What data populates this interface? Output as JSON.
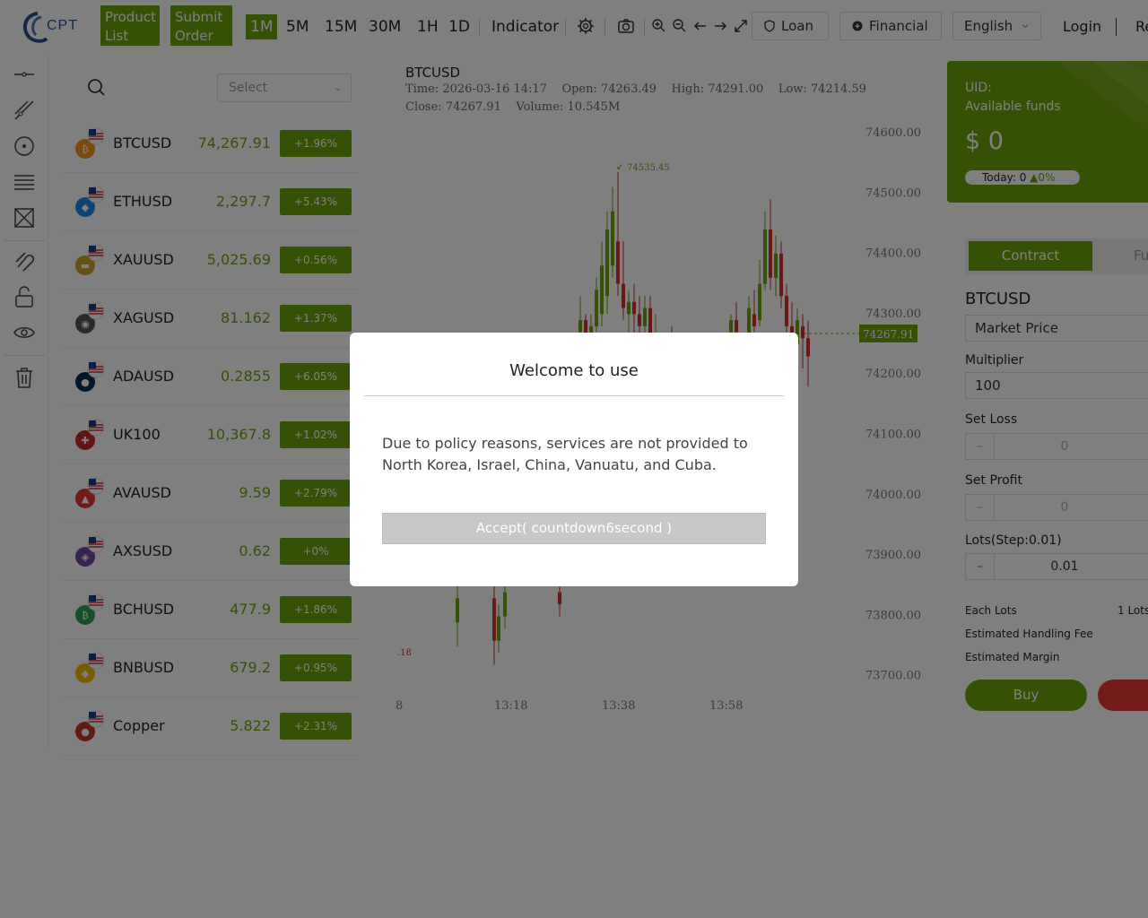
{
  "app": {
    "logo_text": "CPT",
    "brand_color": "#6aa20b"
  },
  "header": {
    "product_list": "Product List",
    "submit_order": "Submit Order",
    "periods": [
      "1M",
      "5M",
      "15M",
      "30M",
      "1H",
      "1D"
    ],
    "active_period": "1M",
    "indicator": "Indicator",
    "loan": "Loan",
    "financial": "Financial",
    "language": "English",
    "login": "Login",
    "register_partial": "Re"
  },
  "products": {
    "select_placeholder": "Select",
    "items": [
      {
        "symbol": "BTCUSD",
        "price": "74,267.91",
        "change": "+1.96%"
      },
      {
        "symbol": "ETHUSD",
        "price": "2,297.7",
        "change": "+5.43%"
      },
      {
        "symbol": "XAUUSD",
        "price": "5,025.69",
        "change": "+0.56%"
      },
      {
        "symbol": "XAGUSD",
        "price": "81.162",
        "change": "+1.37%"
      },
      {
        "symbol": "ADAUSD",
        "price": "0.2855",
        "change": "+6.05%"
      },
      {
        "symbol": "UK100",
        "price": "10,367.8",
        "change": "+1.02%"
      },
      {
        "symbol": "AVAUSD",
        "price": "9.59",
        "change": "+2.79%"
      },
      {
        "symbol": "AXSUSD",
        "price": "0.62",
        "change": "+0%"
      },
      {
        "symbol": "BCHUSD",
        "price": "477.9",
        "change": "+1.86%"
      },
      {
        "symbol": "BNBUSD",
        "price": "679.2",
        "change": "+0.95%"
      },
      {
        "symbol": "Copper",
        "price": "5.822",
        "change": "+2.31%"
      }
    ]
  },
  "chart": {
    "symbol": "BTCUSD",
    "info_line1": "Time: 2026-03-16 14:17    Open: 74263.49    High: 74291.00    Low: 74214.59",
    "info_line2": "Close: 74267.91    Volume: 10.545M",
    "high_marker": "74535.45",
    "low_marker_partial": ".18",
    "current_price": "74267.91",
    "y_ticks": [
      "74600.00",
      "74500.00",
      "74400.00",
      "74300.00",
      "74200.00",
      "74100.00",
      "74000.00",
      "73900.00",
      "73800.00",
      "73700.00"
    ],
    "x_ticks": [
      "8",
      "13:18",
      "13:38",
      "13:58"
    ]
  },
  "account": {
    "uid_label": "UID:",
    "available_label": "Available funds",
    "balance": "$ 0",
    "today_label": "Today: 0",
    "today_pct": "0%"
  },
  "order": {
    "tab_contract": "Contract",
    "tab_other_partial": "Fu",
    "symbol": "BTCUSD",
    "price_type": "Market Price",
    "multiplier_label": "Multiplier",
    "multiplier_value": "100",
    "stop_loss_label": "Set Loss",
    "stop_loss_value": "0",
    "take_profit_label": "Set Profit",
    "take_profit_value": "0",
    "lots_label": "Lots(Step:0.01)",
    "lots_value": "0.01",
    "each_lots_label": "Each Lots",
    "each_lots_value": "1 Lots",
    "fee_label": "Estimated Handling Fee",
    "margin_label": "Estimated Margin",
    "buy_label": "Buy"
  },
  "modal": {
    "title": "Welcome to use",
    "body": "Due to policy reasons, services are not provided to North Korea, Israel, China, Vanuatu, and Cuba.",
    "accept_label": "Accept( countdown6second )"
  }
}
